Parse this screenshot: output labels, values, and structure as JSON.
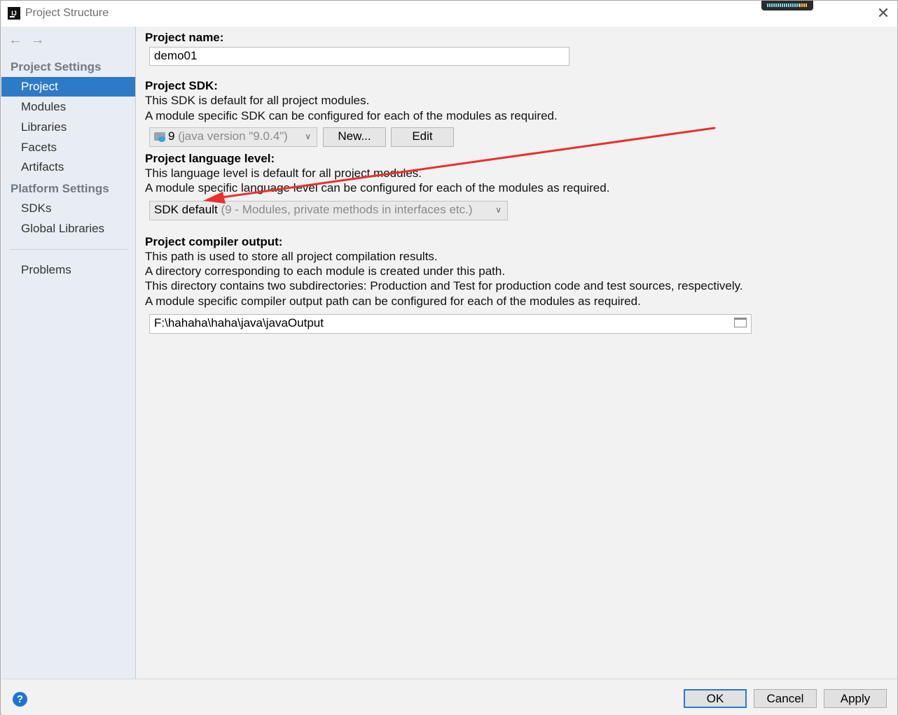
{
  "window": {
    "title": "Project Structure",
    "icon_name": "intellij-idea-icon",
    "close_glyph": "✕"
  },
  "sidebar": {
    "back_glyph": "←",
    "forward_glyph": "→",
    "project_settings_header": "Project Settings",
    "project_items": [
      "Project",
      "Modules",
      "Libraries",
      "Facets",
      "Artifacts"
    ],
    "platform_settings_header": "Platform Settings",
    "platform_items": [
      "SDKs",
      "Global Libraries"
    ],
    "problems": "Problems",
    "selected_item": "Project",
    "selected_color": "#2f7ac6"
  },
  "project_name": {
    "label": "Project name:",
    "value": "demo01"
  },
  "project_sdk": {
    "label": "Project SDK:",
    "desc1": "This SDK is default for all project modules.",
    "desc2": "A module specific SDK can be configured for each of the modules as required.",
    "selected_main": "9",
    "selected_detail": "(java version \"9.0.4\")",
    "new_button": "New...",
    "edit_button": "Edit"
  },
  "language_level": {
    "label": "Project language level:",
    "desc1": "This language level is default for all project modules.",
    "desc2": "A module specific language level can be configured for each of the modules as required.",
    "selected_main": "SDK default",
    "selected_detail": "(9 - Modules, private methods in interfaces etc.)"
  },
  "compiler_output": {
    "label": "Project compiler output:",
    "desc1": "This path is used to store all project compilation results.",
    "desc2": "A directory corresponding to each module is created under this path.",
    "desc3": "This directory contains two subdirectories: Production and Test for production code and test sources, respectively.",
    "desc4": "A module specific compiler output path can be configured for each of the modules as required.",
    "path": "F:\\hahaha\\haha\\java\\javaOutput"
  },
  "footer": {
    "help_glyph": "?",
    "ok": "OK",
    "cancel": "Cancel",
    "apply": "Apply"
  },
  "annotation": {
    "arrow_color": "#e8312f"
  }
}
